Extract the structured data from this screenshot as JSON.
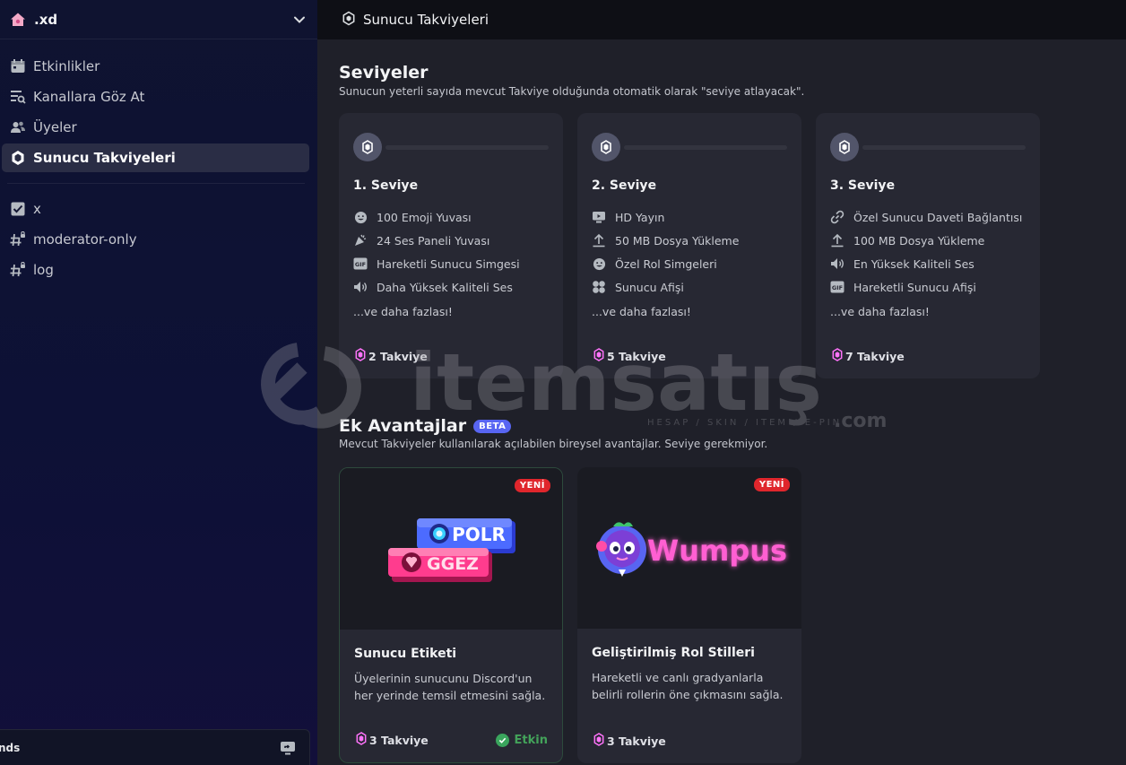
{
  "server": {
    "name": ".xd"
  },
  "sidebar": {
    "items": [
      {
        "label": "Etkinlikler",
        "icon": "calendar-icon"
      },
      {
        "label": "Kanallara Göz At",
        "icon": "browse-channels-icon"
      },
      {
        "label": "Üyeler",
        "icon": "members-icon"
      },
      {
        "label": "Sunucu Takviyeleri",
        "icon": "boost-icon",
        "active": true
      }
    ],
    "channels": [
      {
        "label": "x",
        "icon": "checklist-icon"
      },
      {
        "label": "moderator-only",
        "icon": "locked-hash-icon"
      },
      {
        "label": "log",
        "icon": "locked-hash-icon"
      }
    ],
    "user_panel_text": "nds"
  },
  "topbar": {
    "title": "Sunucu Takviyeleri"
  },
  "levels": {
    "title": "Seviyeler",
    "subtitle": "Sunucun yeterli sayıda mevcut Takviye olduğunda otomatik olarak \"seviye atlayacak\".",
    "tiers": [
      {
        "name": "1. Seviye",
        "perks": [
          {
            "label": "100 Emoji Yuvası",
            "icon": "emoji-icon"
          },
          {
            "label": "24 Ses Paneli Yuvası",
            "icon": "soundboard-icon"
          },
          {
            "label": "Hareketli Sunucu Simgesi",
            "icon": "gif-icon"
          },
          {
            "label": "Daha Yüksek Kaliteli Ses",
            "icon": "speaker-icon"
          }
        ],
        "more": "...ve daha fazlası!",
        "boosts": "2 Takviye"
      },
      {
        "name": "2. Seviye",
        "perks": [
          {
            "label": "HD Yayın",
            "icon": "stream-icon"
          },
          {
            "label": "50 MB Dosya Yükleme",
            "icon": "upload-icon"
          },
          {
            "label": "Özel Rol Simgeleri",
            "icon": "emoji-icon"
          },
          {
            "label": "Sunucu Afişi",
            "icon": "banner-icon"
          }
        ],
        "more": "...ve daha fazlası!",
        "boosts": "5 Takviye"
      },
      {
        "name": "3. Seviye",
        "perks": [
          {
            "label": "Özel Sunucu Daveti Bağlantısı",
            "icon": "link-icon"
          },
          {
            "label": "100 MB Dosya Yükleme",
            "icon": "upload-icon"
          },
          {
            "label": "En Yüksek Kaliteli Ses",
            "icon": "speaker-icon"
          },
          {
            "label": "Hareketli Sunucu Afişi",
            "icon": "gif-icon"
          }
        ],
        "more": "...ve daha fazlası!",
        "boosts": "7 Takviye"
      }
    ]
  },
  "extras": {
    "title": "Ek Avantajlar",
    "badge": "BETA",
    "subtitle": "Mevcut Takviyeler kullanılarak açılabilen bireysel avantajlar. Seviye gerekmiyor.",
    "cards": [
      {
        "badge": "YENİ",
        "art_tags": [
          "POLR",
          "GGEZ"
        ],
        "title": "Sunucu Etiketi",
        "desc": "Üyelerinin sunucunu Discord'un her yerinde temsil etmesini sağla.",
        "boosts": "3 Takviye",
        "status": "Etkin"
      },
      {
        "badge": "YENİ",
        "art_text": "Wumpus",
        "title": "Geliştirilmiş Rol Stilleri",
        "desc": "Hareketli ve canlı gradyanlarla belirli rollerin öne çıkmasını sağla.",
        "boosts": "3 Takviye"
      }
    ]
  },
  "watermark": {
    "brand": "itemsatış",
    "tagline": "HESAP / SKIN / ITEM / E-PIN",
    "suffix": ".com"
  },
  "colors": {
    "accent": "#5865f2",
    "boost_pink": "#ff73fa",
    "new_red": "#e0262c",
    "active_green": "#43a25a"
  }
}
